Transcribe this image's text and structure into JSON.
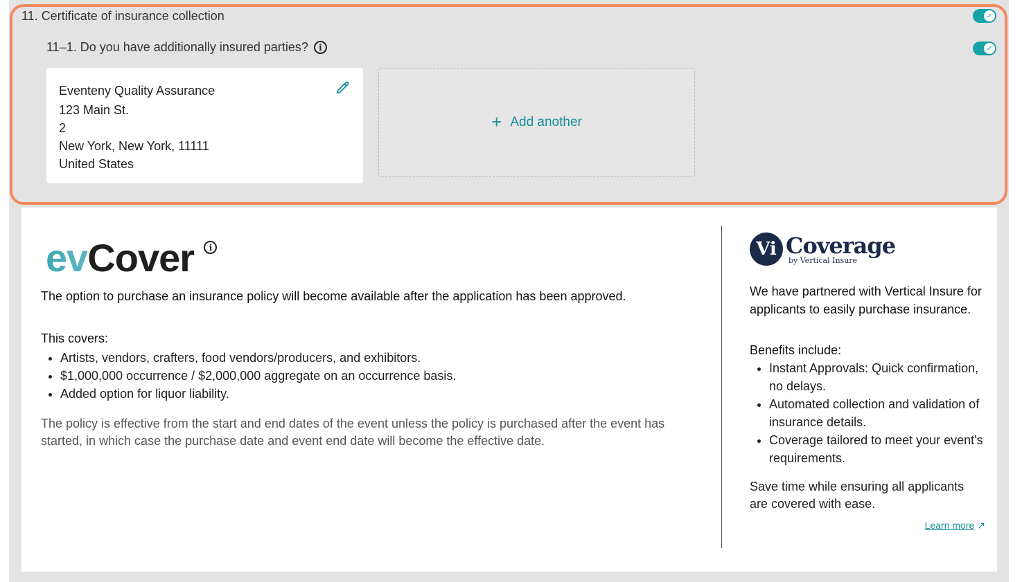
{
  "section": {
    "title": "11. Certificate of insurance collection",
    "question": "11–1. Do you have additionally insured parties?"
  },
  "icons": {
    "info": "info-icon",
    "edit": "pencil-icon",
    "toggle_check": "check-icon",
    "external": "arrow-up-right-icon"
  },
  "toggles": {
    "section_enabled": true,
    "question_enabled": true
  },
  "party": {
    "name": "Eventeny Quality Assurance",
    "address1": "123 Main St.",
    "address2": "2",
    "city_line": "New York, New York, 11111",
    "country": "United States"
  },
  "add_another": {
    "label": "Add another"
  },
  "evcover": {
    "logo_ev": "ev",
    "logo_cover": "Cover",
    "notice": "The option to purchase an insurance policy will become available after the application has been approved.",
    "covers_title": "This covers:",
    "covers": [
      "Artists, vendors, crafters, food vendors/producers, and exhibitors.",
      "$1,000,000 occurrence / $2,000,000 aggregate on an occurrence basis.",
      "Added option for liquor liability."
    ],
    "policy": "The policy is effective from the start and end dates of the event unless the policy is purchased after the event has started, in which case the purchase date and event end date will become the effective date."
  },
  "vertical": {
    "logo_mark": "Vi",
    "logo_word": "Coverage",
    "logo_by": "by Vertical Insure",
    "partner": "We have partnered with Vertical Insure for applicants to easily purchase insurance.",
    "benefits_title": "Benefits include:",
    "benefits": [
      "Instant Approvals: Quick confirmation, no delays.",
      "Automated collection and validation of insurance details.",
      "Coverage tailored to meet your event's requirements."
    ],
    "save_time": "Save time while ensuring all applicants are covered with ease.",
    "learn_more": "Learn more"
  },
  "colors": {
    "accent": "#16a3a7",
    "highlight": "#f2895f",
    "navy": "#1c2a4a"
  }
}
